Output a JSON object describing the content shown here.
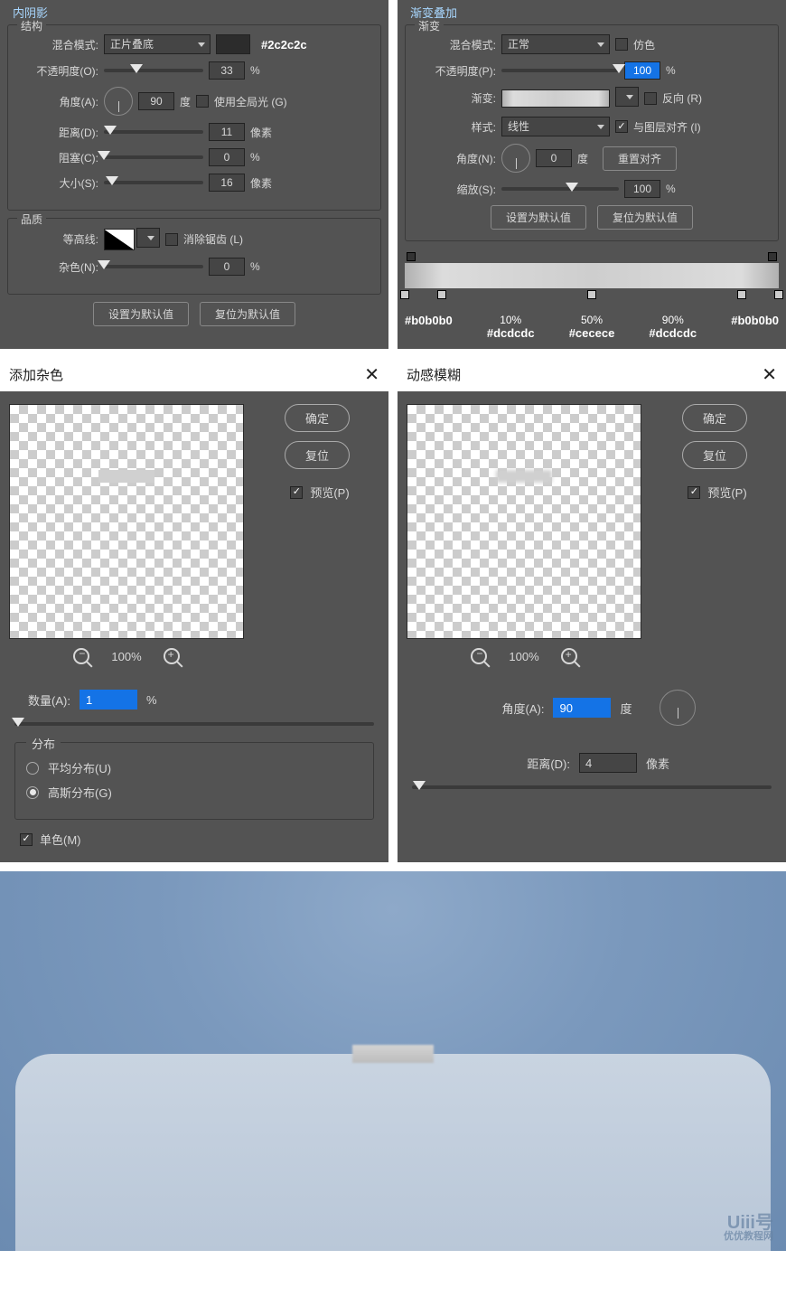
{
  "innerShadow": {
    "title": "内阴影",
    "section1": "结构",
    "blendLabel": "混合模式:",
    "blendValue": "正片叠底",
    "colorHex": "#2c2c2c",
    "opacityLabel": "不透明度(O):",
    "opacityValue": "33",
    "pct": "%",
    "angleLabel": "角度(A):",
    "angleValue": "90",
    "deg": "度",
    "globalLight": "使用全局光 (G)",
    "distanceLabel": "距离(D):",
    "distanceValue": "11",
    "px": "像素",
    "chokeLabel": "阻塞(C):",
    "chokeValue": "0",
    "sizeLabel": "大小(S):",
    "sizeValue": "16",
    "section2": "品质",
    "contourLabel": "等高线:",
    "antialias": "消除锯齿 (L)",
    "noiseLabel": "杂色(N):",
    "noiseValue": "0",
    "btnDefault": "设置为默认值",
    "btnReset": "复位为默认值"
  },
  "gradOverlay": {
    "title": "渐变叠加",
    "section": "渐变",
    "blendLabel": "混合模式:",
    "blendValue": "正常",
    "dither": "仿色",
    "opacityLabel": "不透明度(P):",
    "opacityValue": "100",
    "pct": "%",
    "gradLabel": "渐变:",
    "reverse": "反向 (R)",
    "styleLabel": "样式:",
    "styleValue": "线性",
    "alignLayer": "与图层对齐 (I)",
    "angleLabel": "角度(N):",
    "angleValue": "0",
    "deg": "度",
    "resetAlign": "重置对齐",
    "scaleLabel": "缩放(S):",
    "scaleValue": "100",
    "btnDefault": "设置为默认值",
    "btnReset": "复位为默认值",
    "stops": [
      {
        "pct": "",
        "hex": "#b0b0b0"
      },
      {
        "pct": "10%",
        "hex": "#dcdcdc"
      },
      {
        "pct": "50%",
        "hex": "#cecece"
      },
      {
        "pct": "90%",
        "hex": "#dcdcdc"
      },
      {
        "pct": "",
        "hex": "#b0b0b0"
      }
    ]
  },
  "addNoise": {
    "title": "添加杂色",
    "ok": "确定",
    "reset": "复位",
    "preview": "预览(P)",
    "zoom": "100%",
    "amountLabel": "数量(A):",
    "amountValue": "1",
    "pct": "%",
    "distTitle": "分布",
    "distUniform": "平均分布(U)",
    "distGauss": "高斯分布(G)",
    "mono": "单色(M)"
  },
  "motionBlur": {
    "title": "动感模糊",
    "ok": "确定",
    "reset": "复位",
    "preview": "预览(P)",
    "zoom": "100%",
    "angleLabel": "角度(A):",
    "angleValue": "90",
    "deg": "度",
    "distanceLabel": "距离(D):",
    "distanceValue": "4",
    "px": "像素"
  },
  "watermark": {
    "brand": "Uiii号",
    "sub": "优优教程网"
  }
}
